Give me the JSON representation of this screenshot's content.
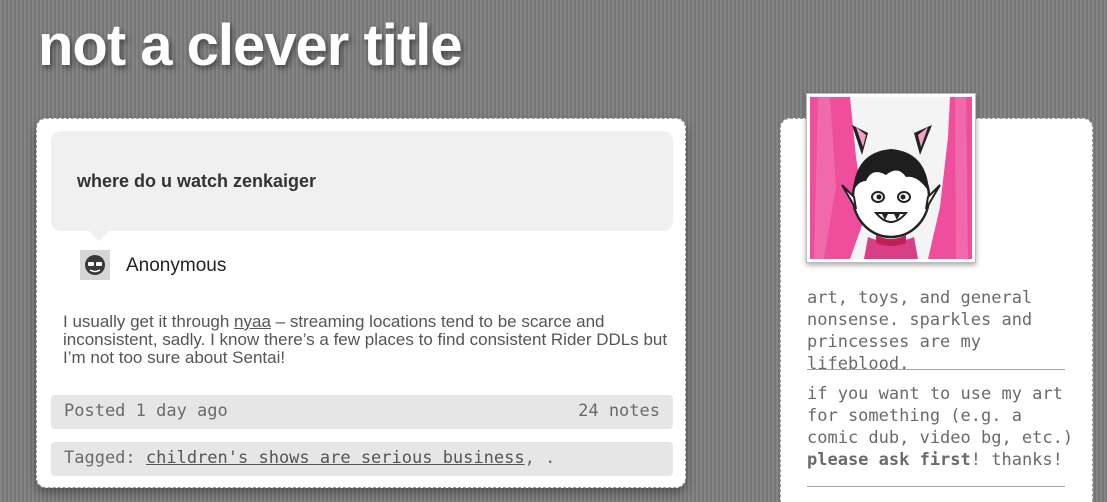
{
  "blog": {
    "title": "not a clever title"
  },
  "post": {
    "question": "where do u watch zenkaiger",
    "asker": "Anonymous",
    "answer": {
      "part1": "I usually get it through ",
      "link": "nyaa",
      "part2": " – streaming locations tend to be scarce and inconsistent, sadly. I know there’s a few places to find consistent Rider DDLs but I’m not too sure about Sentai!"
    },
    "posted": "Posted 1 day ago",
    "notes": "24 notes",
    "tags_label": "Tagged: ",
    "tags": [
      "children's shows are serious business"
    ],
    "tags_tail": ", ."
  },
  "sidebar": {
    "description": "art, toys, and general nonsense. sparkles and princesses are my lifeblood.",
    "art_note": {
      "part1": "if you want to use my art for something (e.g. a comic dub, video bg, etc.) ",
      "bold": "please ask first",
      "part2": "! thanks!"
    }
  },
  "colors": {
    "background": "#7d7d7d",
    "card": "#ffffff",
    "bubble": "#f0f0f0",
    "meta_bar": "#e6e6e6",
    "text_gray": "#6a6a6a",
    "avatar_pink": "#ee4e9c"
  },
  "icons": {
    "asker_avatar": "anonymous-sunglasses-icon"
  }
}
